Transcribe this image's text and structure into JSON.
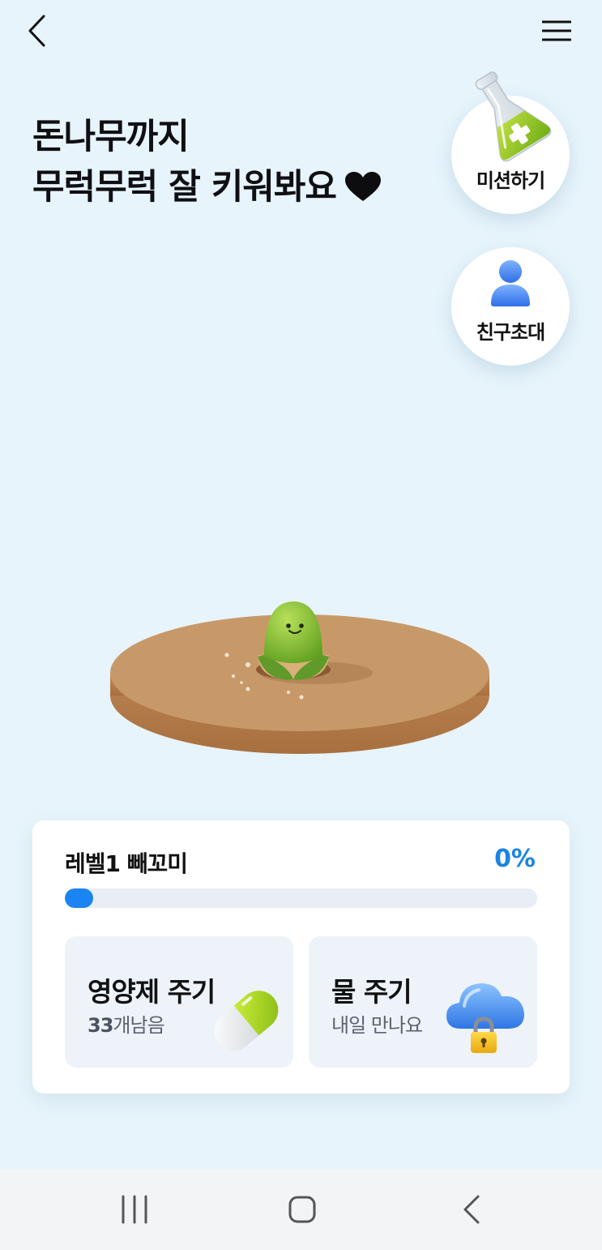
{
  "header": {
    "back_icon": "chevron-left-icon",
    "menu_icon": "hamburger-menu-icon"
  },
  "headline": {
    "line1": "돈나무까지",
    "line2": "무럭무럭 잘 키워봐요",
    "heart_icon": "heart-icon"
  },
  "floating_buttons": {
    "mission": {
      "label": "미션하기",
      "icon": "flask-icon"
    },
    "invite": {
      "label": "친구초대",
      "icon": "person-icon"
    }
  },
  "tree": {
    "icon": "sprout-icon"
  },
  "level_card": {
    "level_label": "레벨1 빼꼬미",
    "percent_text": "0%",
    "progress_value": 0,
    "actions": [
      {
        "title": "영양제 주기",
        "count": "33",
        "count_suffix": "개남음",
        "icon": "pill-icon"
      },
      {
        "title": "물 주기",
        "subtitle": "내일 만나요",
        "icon": "locked-cloud-icon"
      }
    ]
  },
  "system_nav": {
    "recent_icon": "recent-apps-icon",
    "home_icon": "home-icon",
    "back_icon": "back-icon"
  },
  "colors": {
    "background": "#e7f4fb",
    "accent": "#1a84e6",
    "progress_fill": "#1a84f2",
    "tile_background": "#eef3fa"
  }
}
